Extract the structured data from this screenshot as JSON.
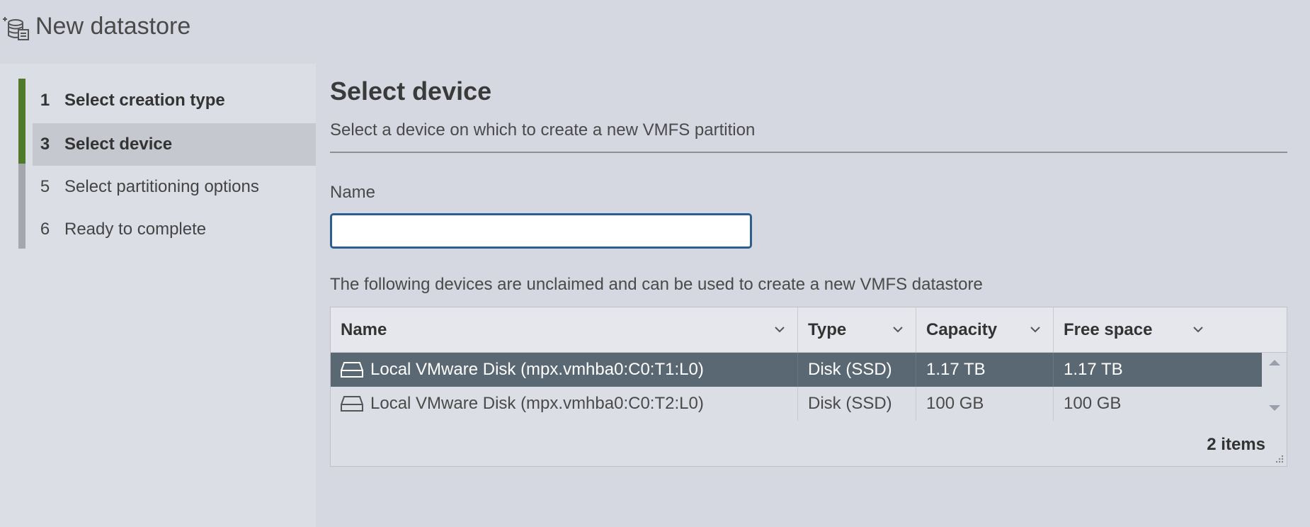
{
  "window": {
    "title": "New datastore",
    "icon": "datastore-icon"
  },
  "wizard": {
    "steps": [
      {
        "num": "1",
        "label": "Select creation type",
        "state": "done"
      },
      {
        "num": "3",
        "label": "Select device",
        "state": "active"
      },
      {
        "num": "5",
        "label": "Select partitioning options",
        "state": "pending"
      },
      {
        "num": "6",
        "label": "Ready to complete",
        "state": "pending"
      }
    ]
  },
  "main": {
    "title": "Select device",
    "subtitle": "Select a device on which to create a new VMFS partition",
    "name_label": "Name",
    "name_value": "",
    "info_text": "The following devices are unclaimed and can be used to create a new VMFS datastore"
  },
  "table": {
    "columns": [
      "Name",
      "Type",
      "Capacity",
      "Free space"
    ],
    "rows": [
      {
        "name": "Local VMware Disk (mpx.vmhba0:C0:T1:L0)",
        "type": "Disk (SSD)",
        "capacity": "1.17 TB",
        "free": "1.17 TB",
        "selected": true
      },
      {
        "name": "Local VMware Disk (mpx.vmhba0:C0:T2:L0)",
        "type": "Disk (SSD)",
        "capacity": "100 GB",
        "free": "100 GB",
        "selected": false
      }
    ],
    "footer": "2 items"
  },
  "colors": {
    "accent_done": "#4e7a29",
    "selected_row": "#5a6874",
    "input_border": "#2c5f8f"
  }
}
